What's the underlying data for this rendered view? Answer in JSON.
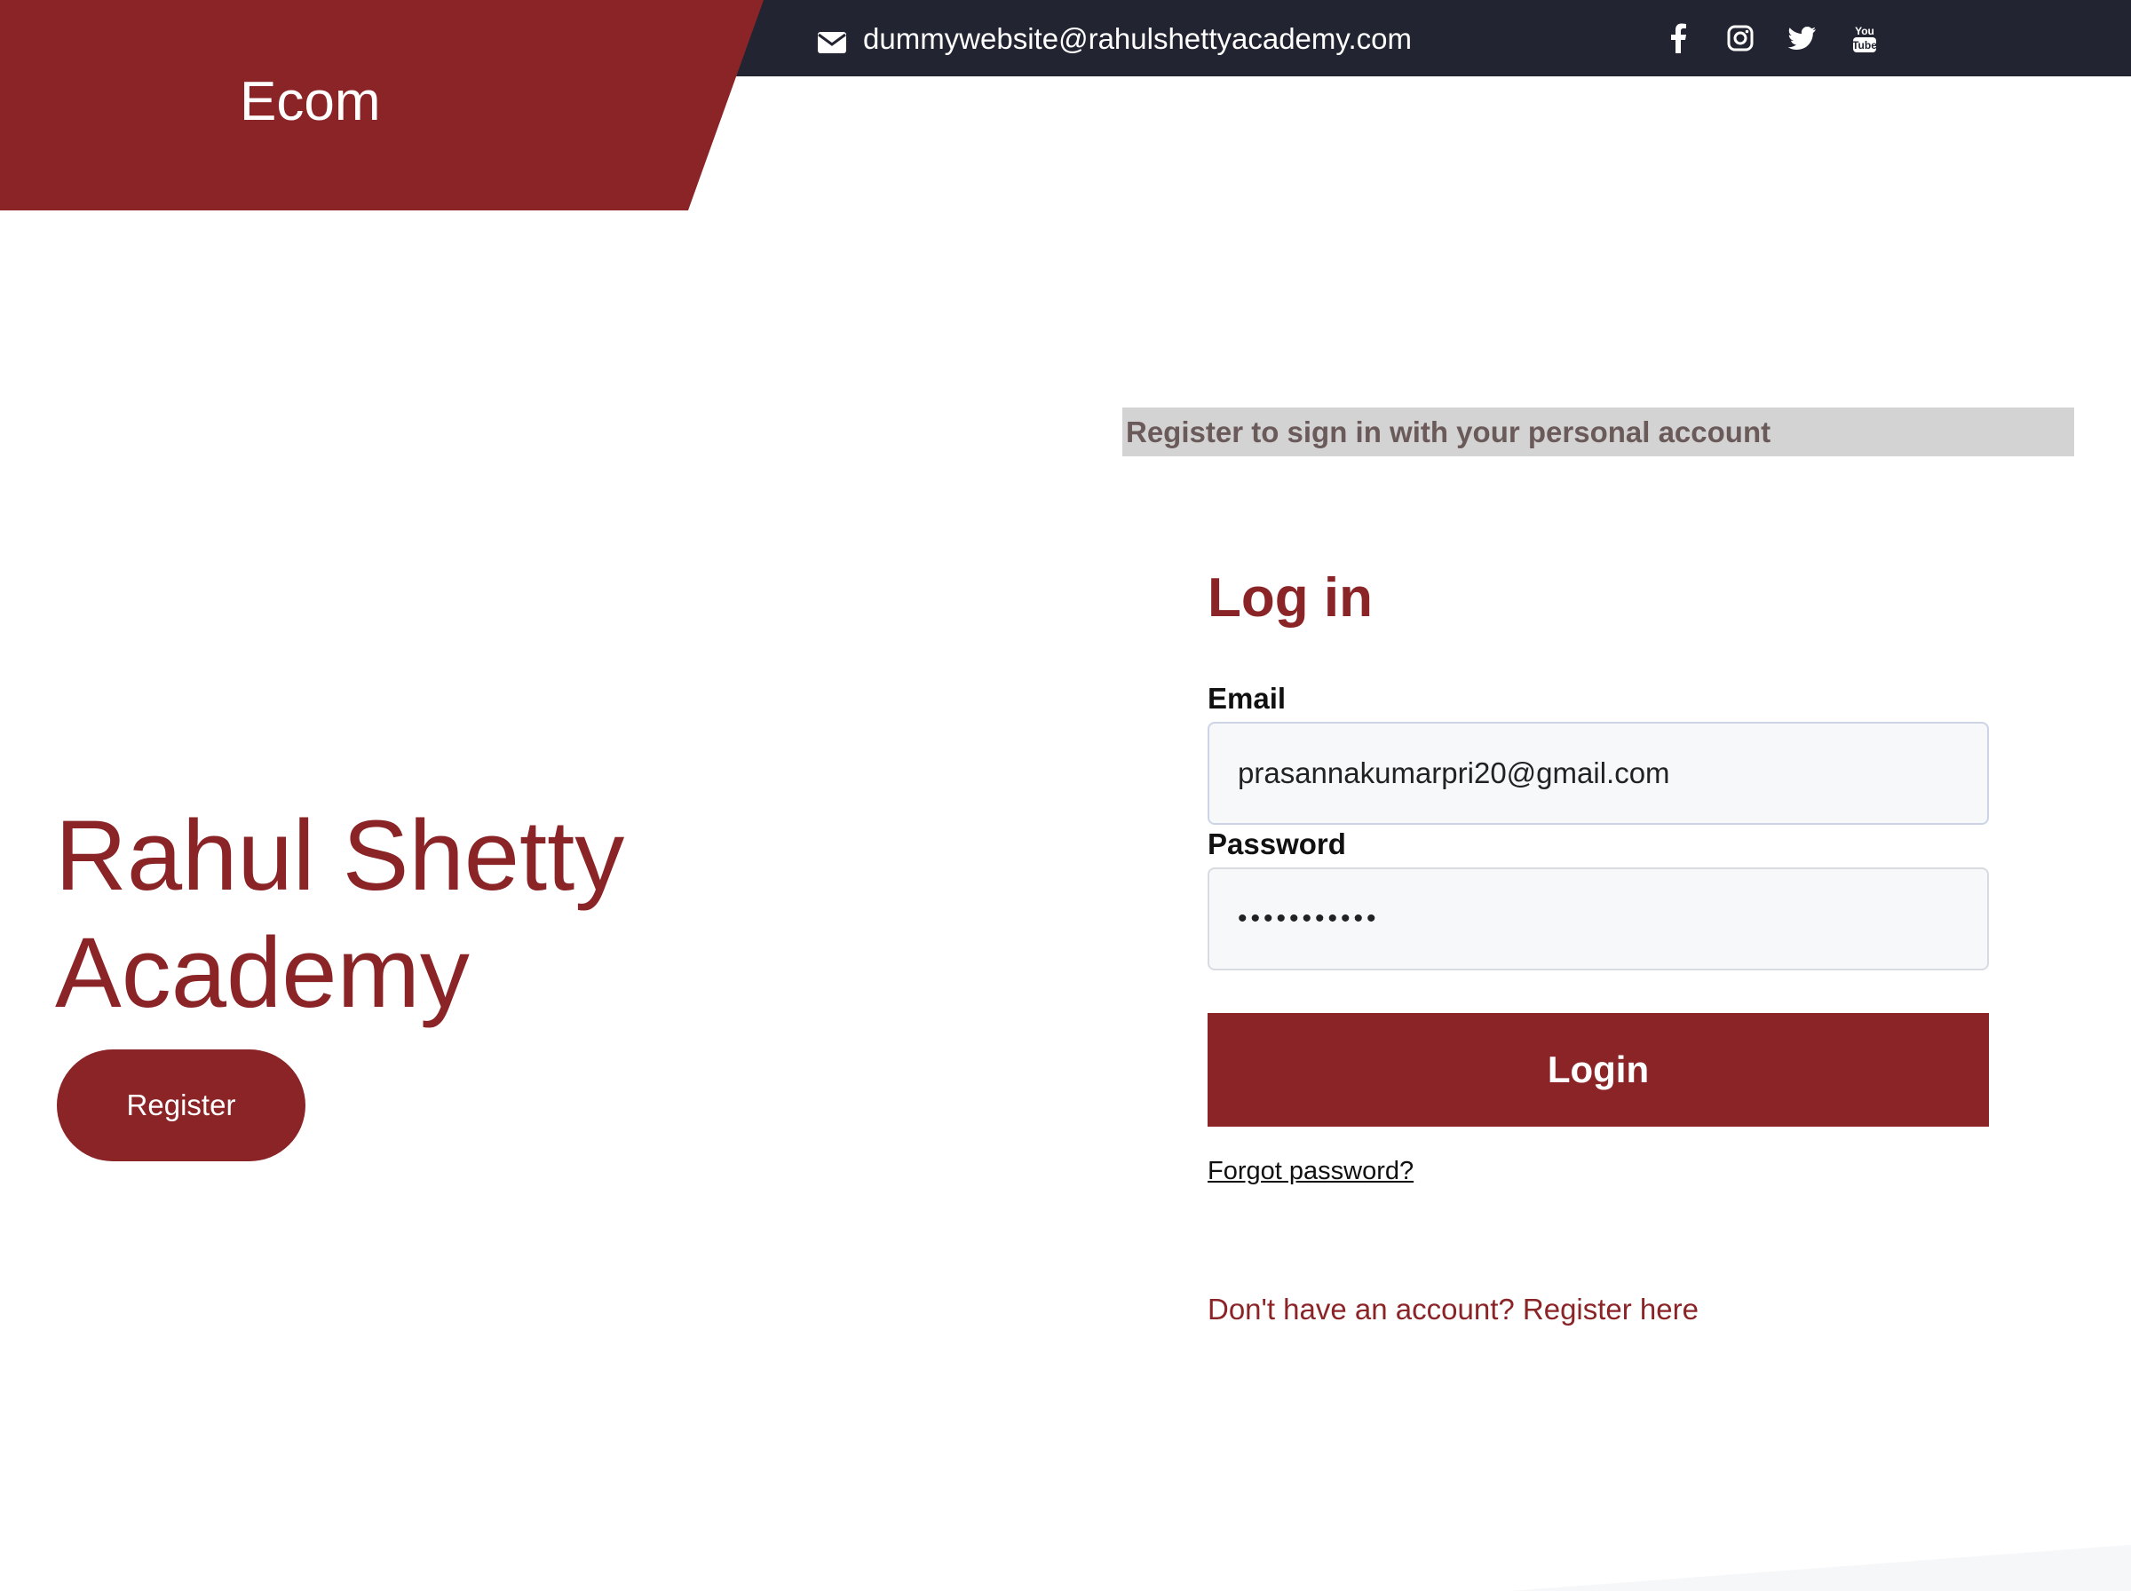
{
  "brand": {
    "title": "Ecom"
  },
  "topbar": {
    "email": "dummywebsite@rahulshettyacademy.com",
    "socials": [
      {
        "icon": "facebook-icon"
      },
      {
        "icon": "instagram-icon"
      },
      {
        "icon": "twitter-icon"
      },
      {
        "icon": "youtube-icon",
        "label": "You Tube"
      }
    ]
  },
  "hero": {
    "title_line1": "Rahul Shetty",
    "title_line2": "Academy",
    "register_label": "Register"
  },
  "banner": {
    "text": "Register to sign in with your personal account"
  },
  "login": {
    "heading": "Log in",
    "email_label": "Email",
    "email_value": "prasannakumarpri20@gmail.com",
    "password_label": "Password",
    "password_value": "•••••••••••",
    "button_label": "Login",
    "forgot_label": "Forgot password?",
    "register_prompt": "Don't have an account? Register here"
  },
  "colors": {
    "brand": "#8b2427",
    "topbar": "#222531",
    "banner": "#d3d3d3"
  }
}
